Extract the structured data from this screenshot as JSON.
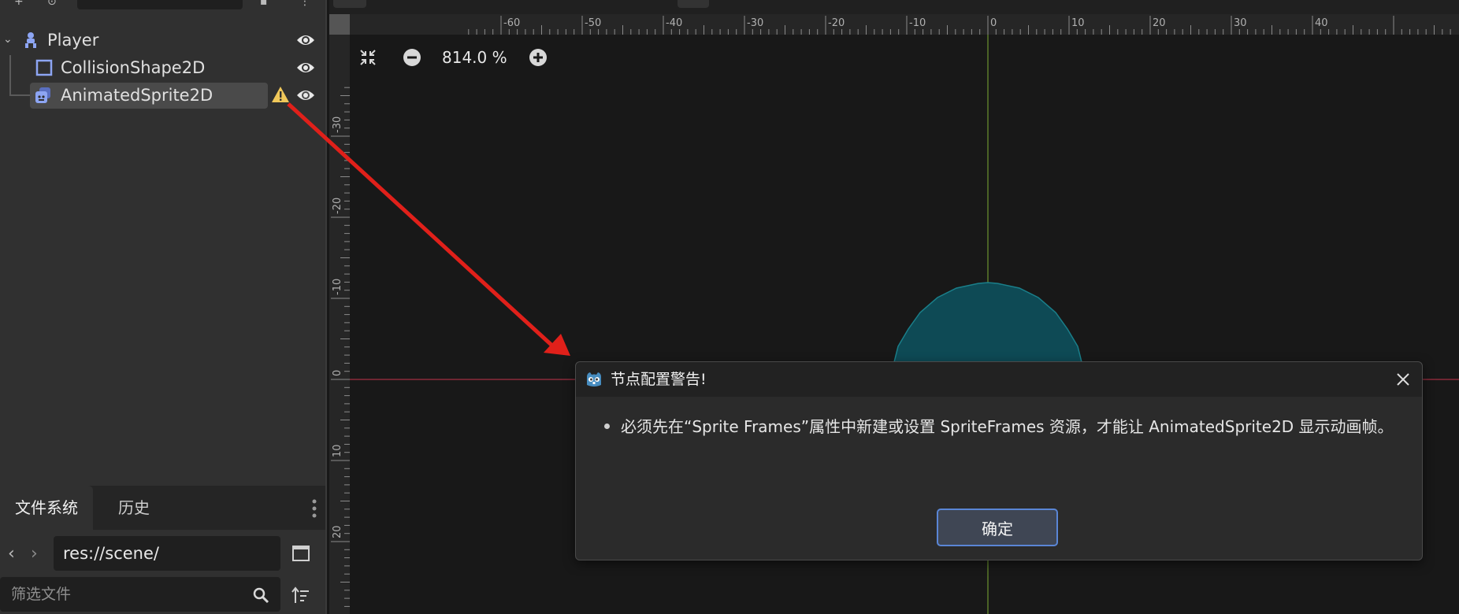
{
  "scene_tree": {
    "nodes": [
      {
        "label": "Player",
        "icon": "character-body-icon"
      },
      {
        "label": "CollisionShape2D",
        "icon": "collision-shape-icon"
      },
      {
        "label": "AnimatedSprite2D",
        "icon": "animated-sprite-icon",
        "selected": true,
        "warning": true
      }
    ]
  },
  "filesystem": {
    "tabs": [
      "文件系统",
      "历史"
    ],
    "path": "res://scene/",
    "filter_placeholder": "筛选文件"
  },
  "viewport": {
    "zoom": "814.0 %",
    "ruler_h_labels": [
      "-60",
      "-50",
      "-40",
      "-30",
      "-20",
      "-10",
      "0",
      "10",
      "20",
      "30",
      "40"
    ],
    "ruler_v_labels": [
      "-30",
      "-20",
      "-10",
      "0",
      "10",
      "20"
    ],
    "colors": {
      "x_axis": "#8a2a3a",
      "y_axis": "#5a7a2a",
      "shape_fill": "#0e4a55",
      "shape_stroke": "#1a7f8a",
      "arrow": "#e0201a"
    }
  },
  "dialog": {
    "title": "节点配置警告!",
    "message": "必须先在“Sprite Frames”属性中新建或设置 SpriteFrames 资源，才能让 AnimatedSprite2D 显示动画帧。",
    "ok_label": "确定"
  }
}
